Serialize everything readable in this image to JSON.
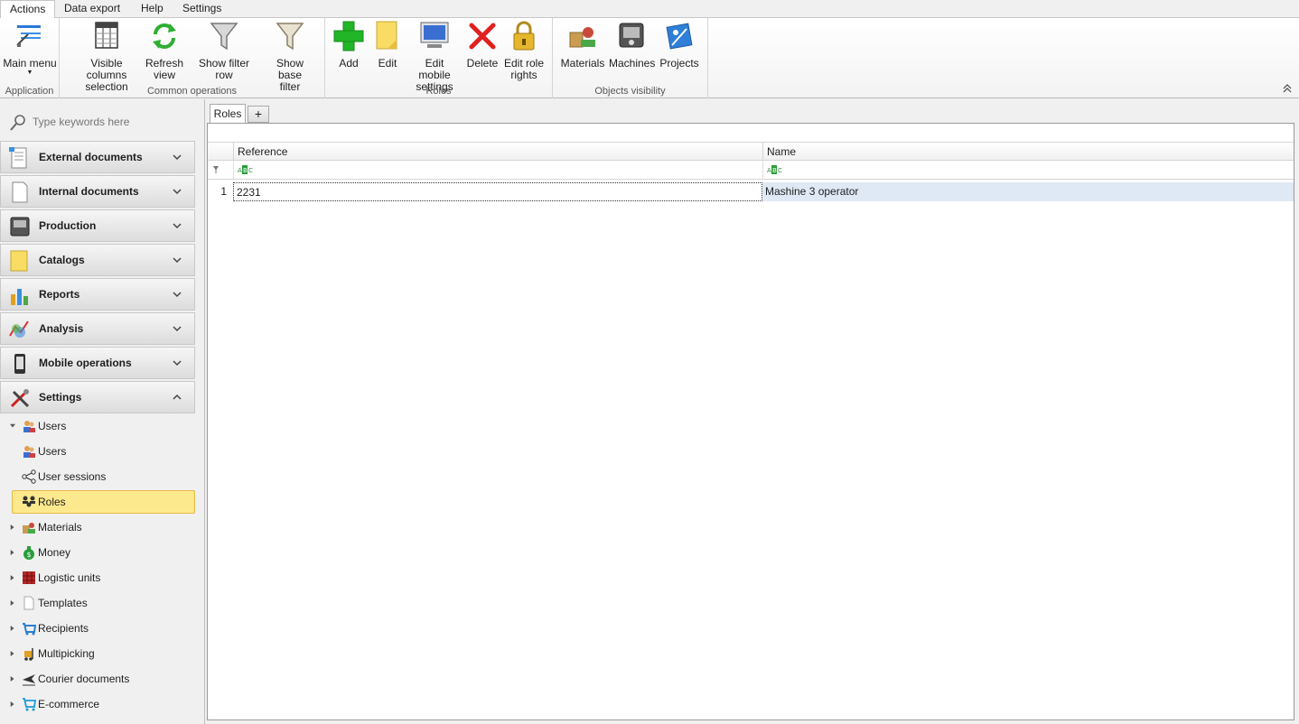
{
  "ribbon": {
    "tabs": [
      "Actions",
      "Data export",
      "Help",
      "Settings"
    ],
    "groups": {
      "application": {
        "label": "Application",
        "buttons": {
          "main_menu": "Main menu"
        }
      },
      "common": {
        "label": "Common operations",
        "buttons": {
          "visible_columns_1": "Visible columns",
          "visible_columns_2": "selection",
          "refresh_1": "Refresh",
          "refresh_2": "view",
          "show_filter_row": "Show filter row",
          "show_base_filter_1": "Show base",
          "show_base_filter_2": "filter"
        }
      },
      "roles": {
        "label": "Roles",
        "buttons": {
          "add": "Add",
          "edit": "Edit",
          "edit_mobile_1": "Edit mobile",
          "edit_mobile_2": "settings",
          "delete": "Delete",
          "edit_rights_1": "Edit role",
          "edit_rights_2": "rights"
        }
      },
      "objects": {
        "label": "Objects visibility",
        "buttons": {
          "materials": "Materials",
          "machines": "Machines",
          "projects": "Projects"
        }
      }
    }
  },
  "sidebar": {
    "search_placeholder": "Type keywords here",
    "sections": [
      {
        "label": "External documents",
        "icon": "external-documents-icon"
      },
      {
        "label": "Internal documents",
        "icon": "internal-documents-icon"
      },
      {
        "label": "Production",
        "icon": "production-icon"
      },
      {
        "label": "Catalogs",
        "icon": "catalogs-icon"
      },
      {
        "label": "Reports",
        "icon": "reports-icon"
      },
      {
        "label": "Analysis",
        "icon": "analysis-icon"
      },
      {
        "label": "Mobile operations",
        "icon": "mobile-operations-icon"
      },
      {
        "label": "Settings",
        "icon": "settings-icon"
      }
    ],
    "tree": [
      {
        "label": "Users"
      },
      {
        "label": "Users"
      },
      {
        "label": "User sessions"
      },
      {
        "label": "Roles"
      },
      {
        "label": "Materials"
      },
      {
        "label": "Money"
      },
      {
        "label": "Logistic units"
      },
      {
        "label": "Templates"
      },
      {
        "label": "Recipients"
      },
      {
        "label": "Multipicking"
      },
      {
        "label": "Courier documents"
      },
      {
        "label": "E-commerce"
      }
    ]
  },
  "content": {
    "tab_label": "Roles",
    "add_tab_label": "+",
    "columns": [
      "Reference",
      "Name"
    ],
    "rows": [
      {
        "index": "1",
        "reference": "2231",
        "name": "Mashine 3 operator"
      }
    ]
  },
  "colors": {
    "selected_bg": "#fde98d",
    "selected_border": "#e8b849",
    "row_highlight": "#dfe9f5"
  }
}
